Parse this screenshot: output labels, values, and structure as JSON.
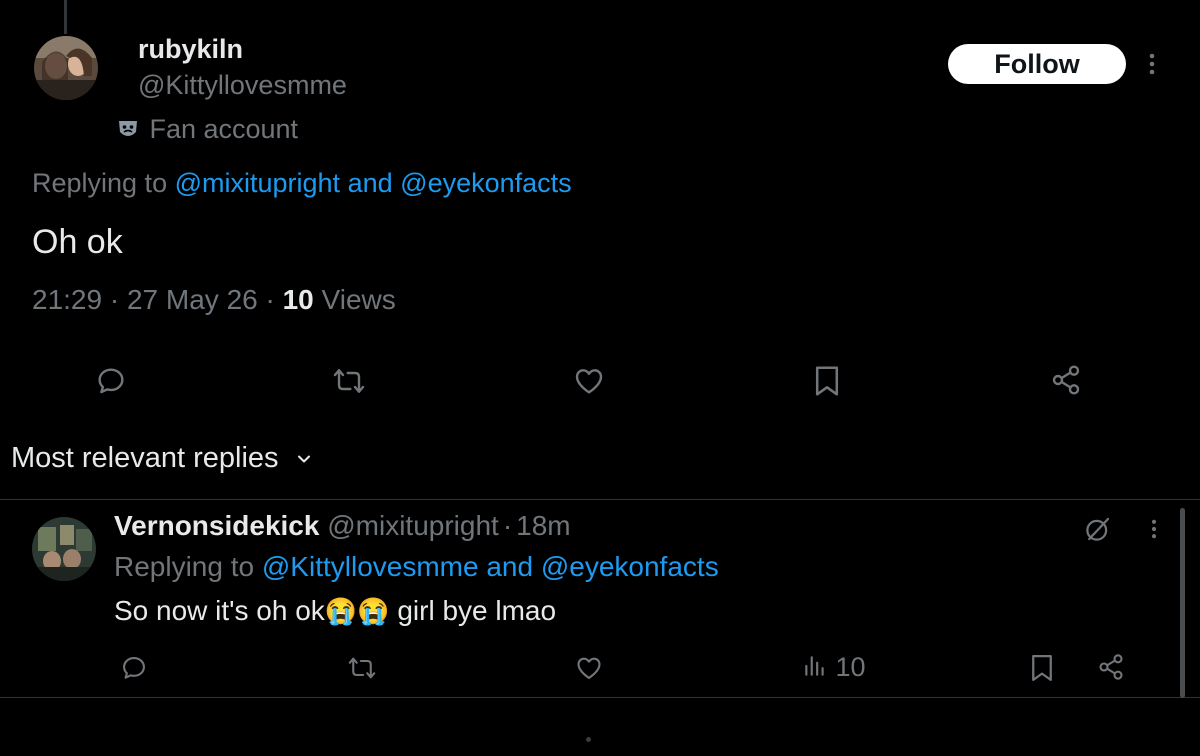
{
  "main_tweet": {
    "display_name": "rubykiln",
    "handle": "@Kittyllovesmme",
    "label_text": "Fan account",
    "follow_label": "Follow",
    "replying_prefix": "Replying to",
    "replying_user1": "@mixitupright",
    "replying_and": "and",
    "replying_user2": "@eyekonfacts",
    "text": "Oh ok",
    "time": "21:29",
    "dot1": "·",
    "date": "27 May 26",
    "dot2": "·",
    "views_count": "10",
    "views_label": "Views",
    "icons": [
      "reply-icon",
      "retweet-icon",
      "like-icon",
      "bookmark-icon",
      "share-icon"
    ]
  },
  "sort": {
    "label": "Most relevant replies"
  },
  "reply": {
    "display_name": "Vernonsidekick",
    "handle": "@mixitupright",
    "dot": "·",
    "time_ago": "18m",
    "replying_prefix": "Replying to",
    "replying_user1": "@Kittyllovesmme",
    "replying_and": "and",
    "replying_user2": "@eyekonfacts",
    "text_before": "So now it's oh ok",
    "emoji": "😭",
    "text_after": "girl bye lmao",
    "views": "10",
    "icons": [
      "reply-icon",
      "retweet-icon",
      "like-icon",
      "views-icon",
      "bookmark-icon",
      "share-icon"
    ]
  },
  "colors": {
    "background": "#000000",
    "text": "#e7e9ea",
    "muted": "#71767b",
    "link": "#1d9bf0",
    "divider": "#2f3336"
  }
}
